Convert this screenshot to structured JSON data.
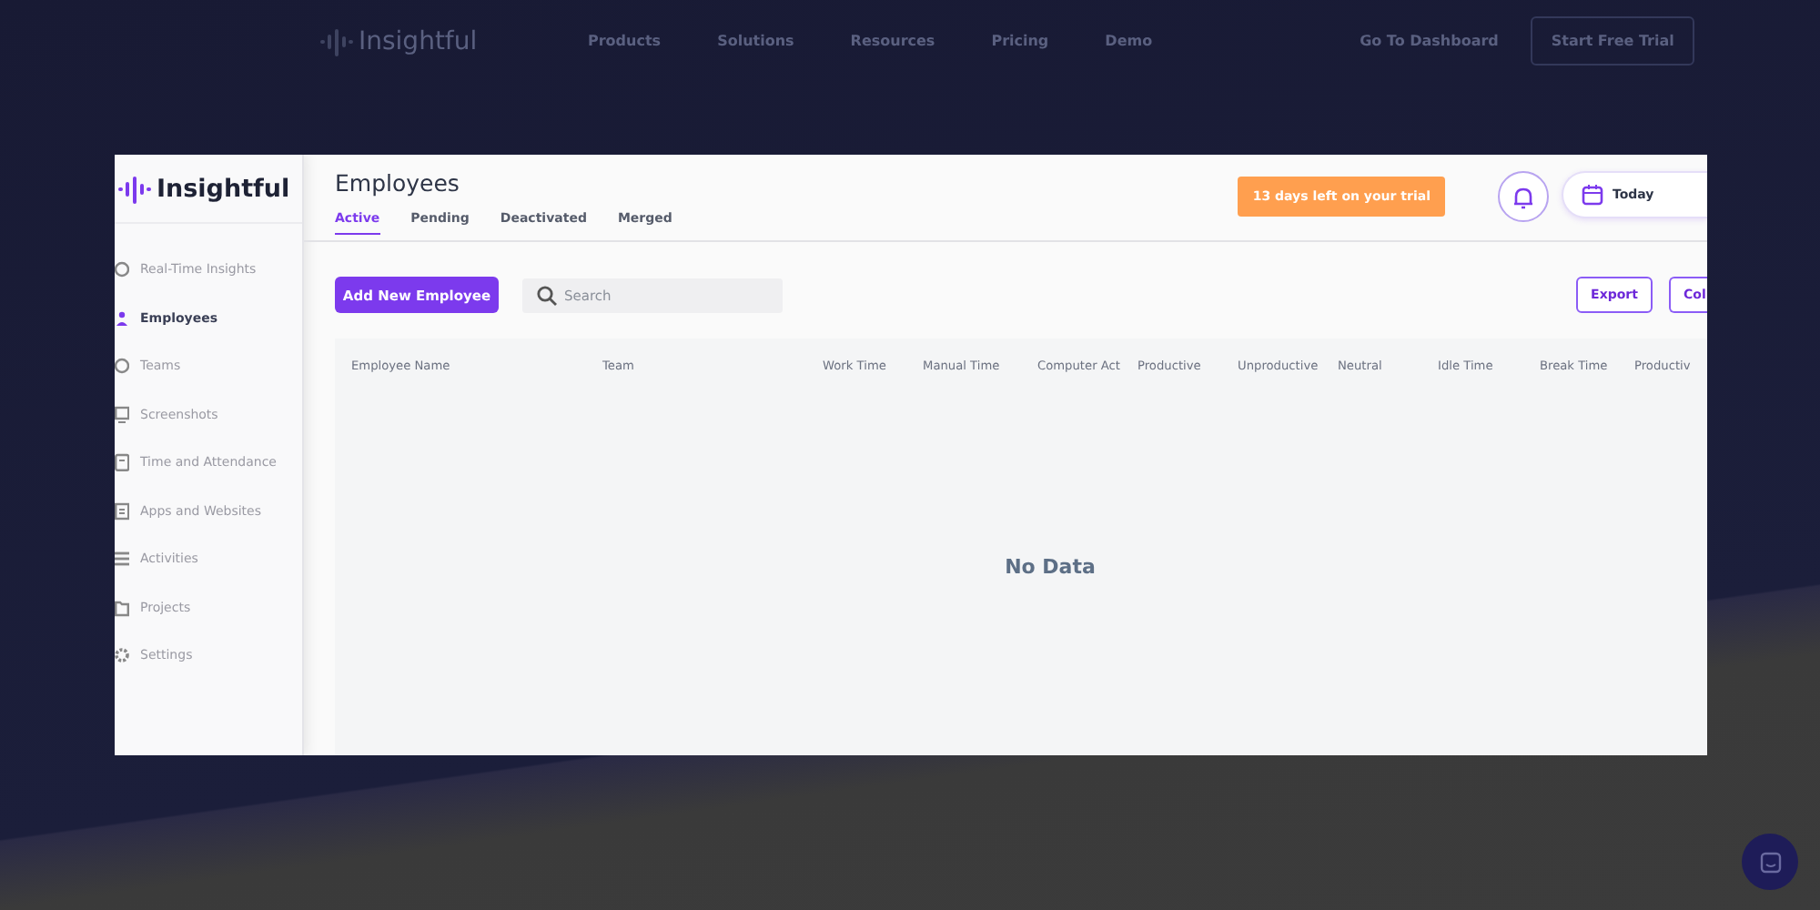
{
  "site_nav": {
    "logo": "Insightful",
    "links": [
      "Products",
      "Solutions",
      "Resources",
      "Pricing",
      "Demo"
    ],
    "dashboard_link": "Go To Dashboard",
    "cta": "Start Free Trial"
  },
  "app": {
    "logo": "Insightful",
    "sidebar": {
      "items": [
        {
          "label": "Real-Time Insights",
          "selected": false
        },
        {
          "label": "Employees",
          "selected": true
        },
        {
          "label": "Teams",
          "selected": false
        },
        {
          "label": "Screenshots",
          "selected": false
        },
        {
          "label": "Time and Attendance",
          "selected": false
        },
        {
          "label": "Apps and Websites",
          "selected": false
        },
        {
          "label": "Activities",
          "selected": false
        },
        {
          "label": "Projects",
          "selected": false
        },
        {
          "label": "Settings",
          "selected": false
        }
      ]
    },
    "page_title": "Employees",
    "tabs": [
      {
        "label": "Active",
        "selected": true
      },
      {
        "label": "Pending",
        "selected": false
      },
      {
        "label": "Deactivated",
        "selected": false
      },
      {
        "label": "Merged",
        "selected": false
      }
    ],
    "trial_badge": "13 days left on your trial",
    "date_picker": {
      "value": "Today"
    },
    "add_button": "Add New Employee",
    "search": {
      "placeholder": "Search"
    },
    "export_button": "Export",
    "columns_button": "Col",
    "table": {
      "columns": [
        "Employee Name",
        "Team",
        "Work Time",
        "Manual Time",
        "Computer Act",
        "Productive",
        "Unproductive",
        "Neutral",
        "Idle Time",
        "Break Time",
        "Productiv"
      ],
      "empty_text": "No Data"
    }
  }
}
